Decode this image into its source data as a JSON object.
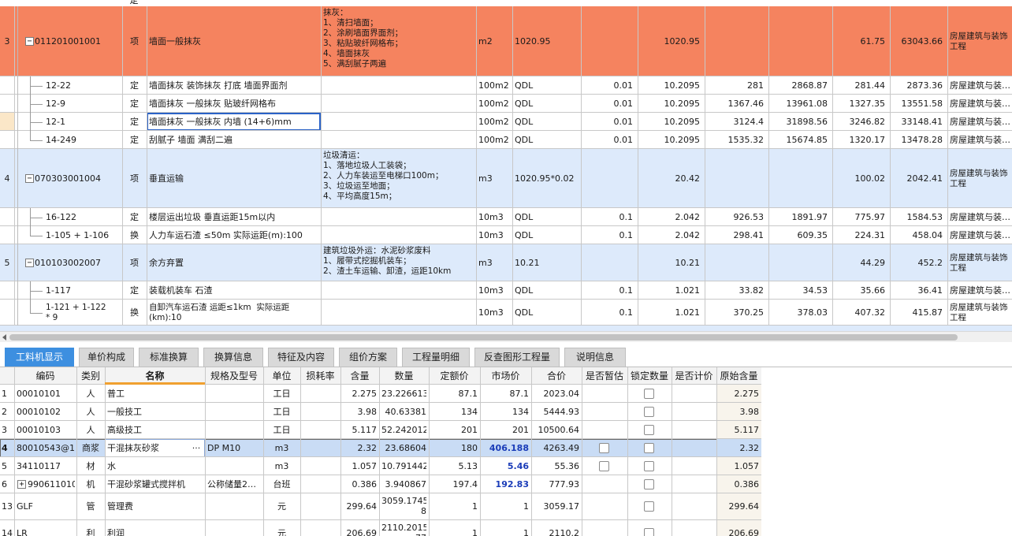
{
  "colors": {
    "orange_row": "#f5835f",
    "blue_row": "#ddeafb",
    "selected_row": "#c9dcf5",
    "selected_border": "#2a62c7",
    "tab_active": "#3d8fe0",
    "blue_value": "#1a3cb8"
  },
  "top_partial": {
    "type": "定"
  },
  "upper_rows": [
    {
      "no": "3",
      "code": "011201001001",
      "type": "项",
      "name": "墙面一般抹灰",
      "feature": "抹灰：\n1、清扫墙面；\n2、涂刷墙面界面剂；\n3、粘贴玻纤网格布；\n4、墙面抹灰\n5、满刮腻子两遍",
      "unit": "m2",
      "expr": "1020.95",
      "coef": "",
      "qty": "1020.95",
      "p1": "",
      "p2": "",
      "p3": "61.75",
      "p4": "63043.66",
      "major": "房屋建筑与装饰\n工程"
    },
    {
      "no": "",
      "code": "12-22",
      "type": "定",
      "name": "墙面抹灰 装饰抹灰 打底 墙面界面剂",
      "feature": "",
      "unit": "100m2",
      "expr": "QDL",
      "coef": "0.01",
      "qty": "10.2095",
      "p1": "281",
      "p2": "2868.87",
      "p3": "281.44",
      "p4": "2873.36",
      "major": "房屋建筑与装…"
    },
    {
      "no": "",
      "code": "12-9",
      "type": "定",
      "name": "墙面抹灰 一般抹灰 贴玻纤网格布",
      "feature": "",
      "unit": "100m2",
      "expr": "QDL",
      "coef": "0.01",
      "qty": "10.2095",
      "p1": "1367.46",
      "p2": "13961.08",
      "p3": "1327.35",
      "p4": "13551.58",
      "major": "房屋建筑与装…"
    },
    {
      "no": "",
      "code": "12-1",
      "type": "定",
      "name": "墙面抹灰 一般抹灰 内墙 (14+6)mm",
      "feature": "",
      "unit": "100m2",
      "expr": "QDL",
      "coef": "0.01",
      "qty": "10.2095",
      "p1": "3124.4",
      "p2": "31898.56",
      "p3": "3246.82",
      "p4": "33148.41",
      "major": "房屋建筑与装…"
    },
    {
      "no": "",
      "code": "14-249",
      "type": "定",
      "name": "刮腻子 墙面 满刮二遍",
      "feature": "",
      "unit": "100m2",
      "expr": "QDL",
      "coef": "0.01",
      "qty": "10.2095",
      "p1": "1535.32",
      "p2": "15674.85",
      "p3": "1320.17",
      "p4": "13478.28",
      "major": "房屋建筑与装…"
    },
    {
      "no": "4",
      "code": "070303001004",
      "type": "项",
      "name": "垂直运输",
      "feature": "垃圾清运：\n1、落地垃圾人工装袋；\n2、人力车装运至电梯口100m；\n3、垃圾运至地面；\n4、平均高度15m；",
      "unit": "m3",
      "expr": "1020.95*0.02",
      "coef": "",
      "qty": "20.42",
      "p1": "",
      "p2": "",
      "p3": "100.02",
      "p4": "2042.41",
      "major": "房屋建筑与装饰\n工程"
    },
    {
      "no": "",
      "code": "16-122",
      "type": "定",
      "name": "楼层运出垃圾 垂直运距15m以内",
      "feature": "",
      "unit": "10m3",
      "expr": "QDL",
      "coef": "0.1",
      "qty": "2.042",
      "p1": "926.53",
      "p2": "1891.97",
      "p3": "775.97",
      "p4": "1584.53",
      "major": "房屋建筑与装…"
    },
    {
      "no": "",
      "code": "1-105 + 1-106",
      "type": "换",
      "name": "人力车运石渣 ≤50m  实际运距(m):100",
      "feature": "",
      "unit": "10m3",
      "expr": "QDL",
      "coef": "0.1",
      "qty": "2.042",
      "p1": "298.41",
      "p2": "609.35",
      "p3": "224.31",
      "p4": "458.04",
      "major": "房屋建筑与装…"
    },
    {
      "no": "5",
      "code": "010103002007",
      "type": "项",
      "name": "余方弃置",
      "feature": "建筑垃圾外运：水泥砂浆废料\n1、履带式挖掘机装车；\n2、渣土车运输、卸渣，运距10km",
      "unit": "m3",
      "expr": "10.21",
      "coef": "",
      "qty": "10.21",
      "p1": "",
      "p2": "",
      "p3": "44.29",
      "p4": "452.2",
      "major": "房屋建筑与装饰\n工程"
    },
    {
      "no": "",
      "code": "1-117",
      "type": "定",
      "name": "装载机装车 石渣",
      "feature": "",
      "unit": "10m3",
      "expr": "QDL",
      "coef": "0.1",
      "qty": "1.021",
      "p1": "33.82",
      "p2": "34.53",
      "p3": "35.66",
      "p4": "36.41",
      "major": "房屋建筑与装…"
    },
    {
      "no": "",
      "code": "1-121 + 1-122\n* 9",
      "type": "换",
      "name": "自卸汽车运石渣 运距≤1km  实际运距\n(km):10",
      "feature": "",
      "unit": "10m3",
      "expr": "QDL",
      "coef": "0.1",
      "qty": "1.021",
      "p1": "370.25",
      "p2": "378.03",
      "p3": "407.32",
      "p4": "415.87",
      "major": "房屋建筑与装饰\n工程"
    }
  ],
  "tabs": [
    "工料机显示",
    "单价构成",
    "标准换算",
    "换算信息",
    "特征及内容",
    "组价方案",
    "工程量明细",
    "反查图形工程量",
    "说明信息"
  ],
  "lower_headers": [
    "编码",
    "类别",
    "名称",
    "规格及型号",
    "单位",
    "损耗率",
    "含量",
    "数量",
    "定额价",
    "市场价",
    "合价",
    "是否暂估",
    "锁定数量",
    "是否计价",
    "原始含量"
  ],
  "lower_rows": [
    {
      "no": "1",
      "code": "00010101",
      "cat": "人",
      "name": "普工",
      "spec": "",
      "unit": "工日",
      "loss": "",
      "content": "2.275",
      "qty": "23.226613",
      "quota": "87.1",
      "market": "87.1",
      "total": "2023.04",
      "est": false,
      "lock": true,
      "orig": "2.275"
    },
    {
      "no": "2",
      "code": "00010102",
      "cat": "人",
      "name": "一般技工",
      "spec": "",
      "unit": "工日",
      "loss": "",
      "content": "3.98",
      "qty": "40.63381",
      "quota": "134",
      "market": "134",
      "total": "5444.93",
      "est": false,
      "lock": true,
      "orig": "3.98"
    },
    {
      "no": "3",
      "code": "00010103",
      "cat": "人",
      "name": "高级技工",
      "spec": "",
      "unit": "工日",
      "loss": "",
      "content": "5.117",
      "qty": "52.242012",
      "quota": "201",
      "market": "201",
      "total": "10500.64",
      "est": false,
      "lock": true,
      "orig": "5.117"
    },
    {
      "no": "4",
      "code": "80010543@1",
      "cat": "商浆",
      "name": "干混抹灰砂浆",
      "spec": "DP M10",
      "unit": "m3",
      "loss": "",
      "content": "2.32",
      "qty": "23.68604",
      "quota": "180",
      "market": "406.188",
      "total": "4263.49",
      "est": true,
      "lock": true,
      "orig": "2.32"
    },
    {
      "no": "5",
      "code": "34110117",
      "cat": "材",
      "name": "水",
      "spec": "",
      "unit": "m3",
      "loss": "",
      "content": "1.057",
      "qty": "10.791442",
      "quota": "5.13",
      "market": "5.46",
      "total": "55.36",
      "est": true,
      "lock": true,
      "orig": "1.057"
    },
    {
      "no": "6",
      "code": "990611010",
      "cat": "机",
      "name": "干混砂浆罐式搅拌机",
      "spec": "公称储量2…",
      "unit": "台班",
      "loss": "",
      "content": "0.386",
      "qty": "3.940867",
      "quota": "197.4",
      "market": "192.83",
      "total": "777.93",
      "est": false,
      "lock": true,
      "orig": "0.386"
    },
    {
      "no": "13",
      "code": "GLF",
      "cat": "管",
      "name": "管理费",
      "spec": "",
      "unit": "元",
      "loss": "",
      "content": "299.64",
      "qty": "3059.1745\n8",
      "quota": "1",
      "market": "1",
      "total": "3059.17",
      "est": false,
      "lock": true,
      "orig": "299.64"
    },
    {
      "no": "14",
      "code": "LR",
      "cat": "利",
      "name": "利润",
      "spec": "",
      "unit": "元",
      "loss": "",
      "content": "206.69",
      "qty": "2110.2015\n77",
      "quota": "1",
      "market": "1",
      "total": "2110.2",
      "est": false,
      "lock": true,
      "orig": "206.69"
    }
  ],
  "ellipsis": "···",
  "plus_sign": "+",
  "minus_sign": "−"
}
